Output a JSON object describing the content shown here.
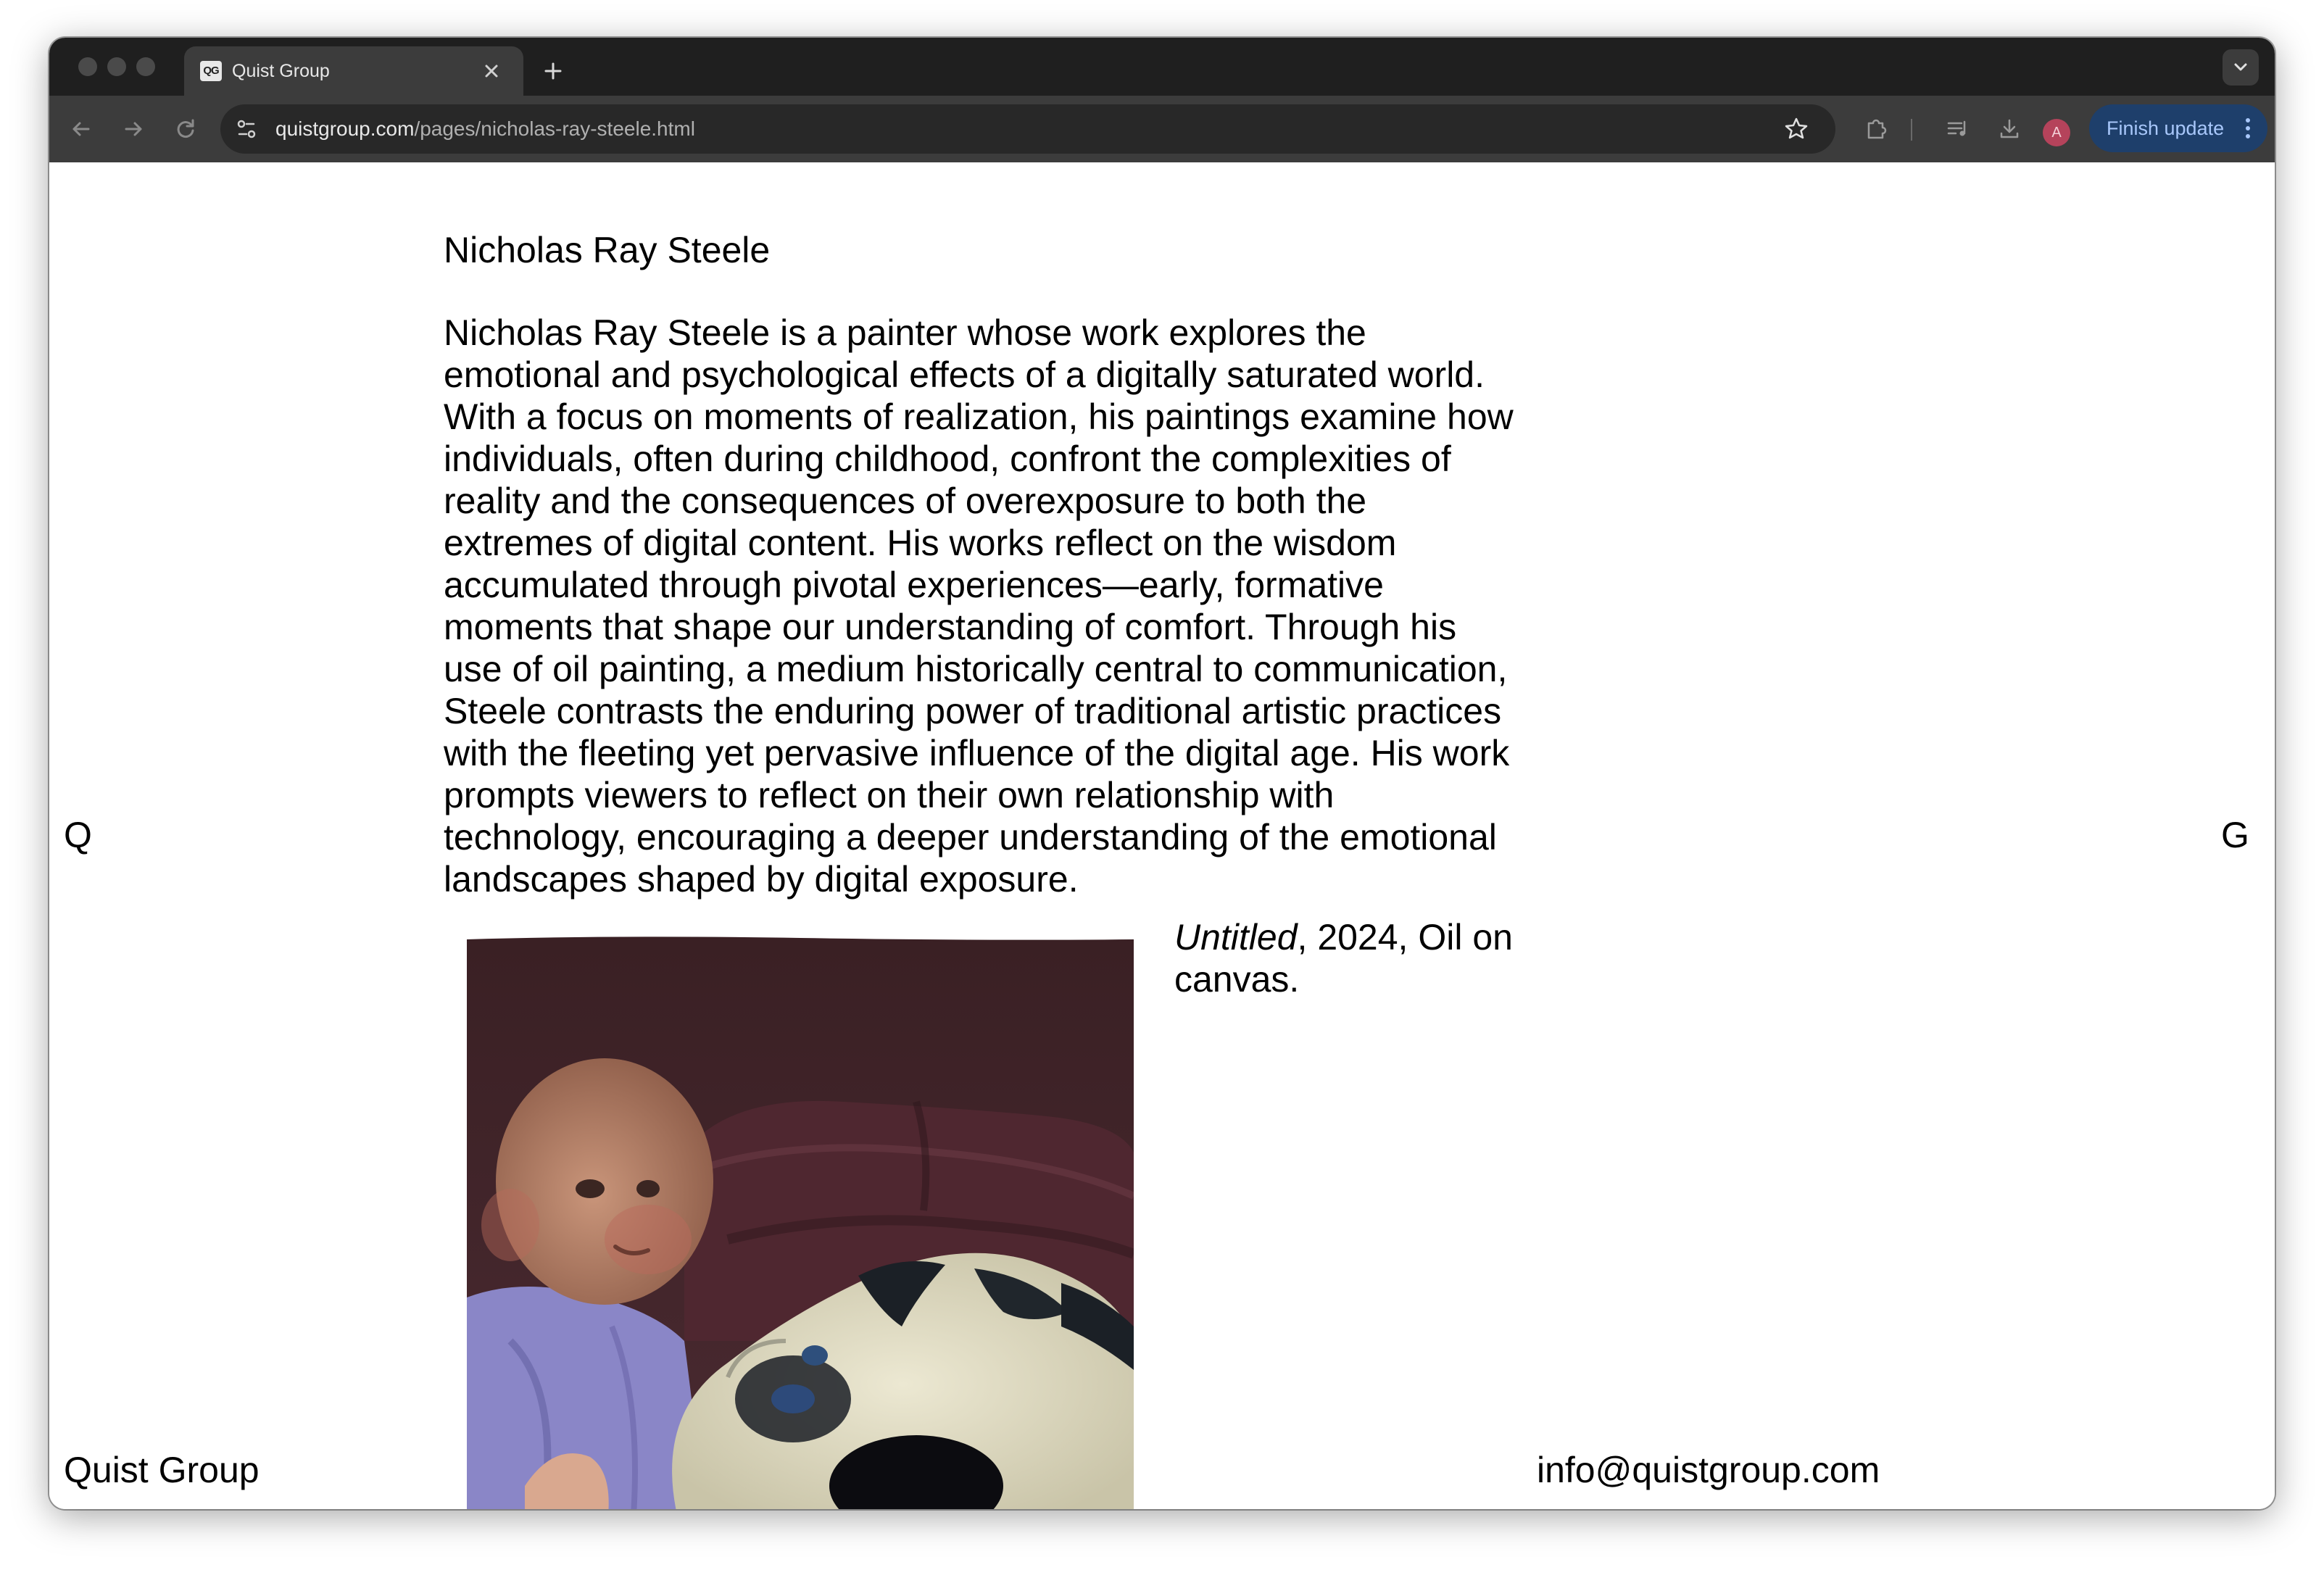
{
  "browser": {
    "tab": {
      "favicon_text": "QG",
      "title": "Quist Group"
    },
    "address_bar": {
      "host": "quistgroup.com",
      "path": "/pages/nicholas-ray-steele.html"
    },
    "profile_initial": "A",
    "update_button_label": "Finish update"
  },
  "page": {
    "left_letter": "Q",
    "right_letter": "G",
    "artist_name": "Nicholas Ray Steele",
    "bio": "Nicholas Ray Steele is a painter whose work explores the emotional and psychological effects of a digitally saturated world. With a focus on moments of realization, his paintings examine how individuals, often during childhood, confront the complexities of reality and the consequences of overexposure to both the extremes of digital content. His works reflect on the wisdom accumulated through pivotal experiences—early, formative moments that shape our understanding of comfort. Through his use of oil painting, a medium historically central to communication, Steele contrasts the enduring power of traditional artistic practices with the fleeting yet pervasive influence of the digital age. His work prompts viewers to reflect on their own relationship with technology, encouraging a deeper understanding of the emotional landscapes shaped by digital exposure.",
    "artwork": {
      "title": "Untitled",
      "details": ", 2024, Oil on canvas."
    },
    "footer": {
      "left": "Quist Group",
      "email": "info@quistgroup.com"
    }
  },
  "colors": {
    "tabstrip_bg": "#1f1f1f",
    "toolbar_bg": "#3c3c3c",
    "omnibox_bg": "#282828",
    "update_button_bg": "#1e3f6b",
    "update_button_text": "#a8c7fa",
    "page_bg": "#ffffff",
    "page_text": "#000000"
  }
}
